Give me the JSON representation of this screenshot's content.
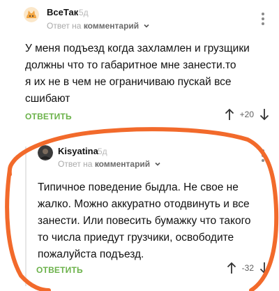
{
  "comments": [
    {
      "author": "ВсеТак",
      "time": "5д",
      "reply_to_prefix": "Ответ на",
      "reply_to_target": "комментарий",
      "text": "У меня подъезд когда захламлен и грузщики\nдолжны что то габаритное мне занести.то\nя их не в чем не ограничиваю пускай все\nсшибают",
      "reply_label": "ОТВЕТИТЬ",
      "score": "+20",
      "avatar_icon": "cat-avatar-icon"
    },
    {
      "author": "Kisyatina",
      "time": "5д",
      "reply_to_prefix": "Ответ на",
      "reply_to_target": "комментарий",
      "text": "Типичное поведение быдла. Не свое не\nжалко. Можно аккуратно отодвинуть и все\nзанести. Или повесить бумажку что такого\nто числа приедут грузчики, освободите\nпожалуйста подъезд.",
      "reply_label": "ОТВЕТИТЬ",
      "score": "-32",
      "avatar_icon": "photo-avatar-icon"
    }
  ],
  "colors": {
    "accent_green": "#6bb24a",
    "annotation_orange": "#f26a2b"
  }
}
